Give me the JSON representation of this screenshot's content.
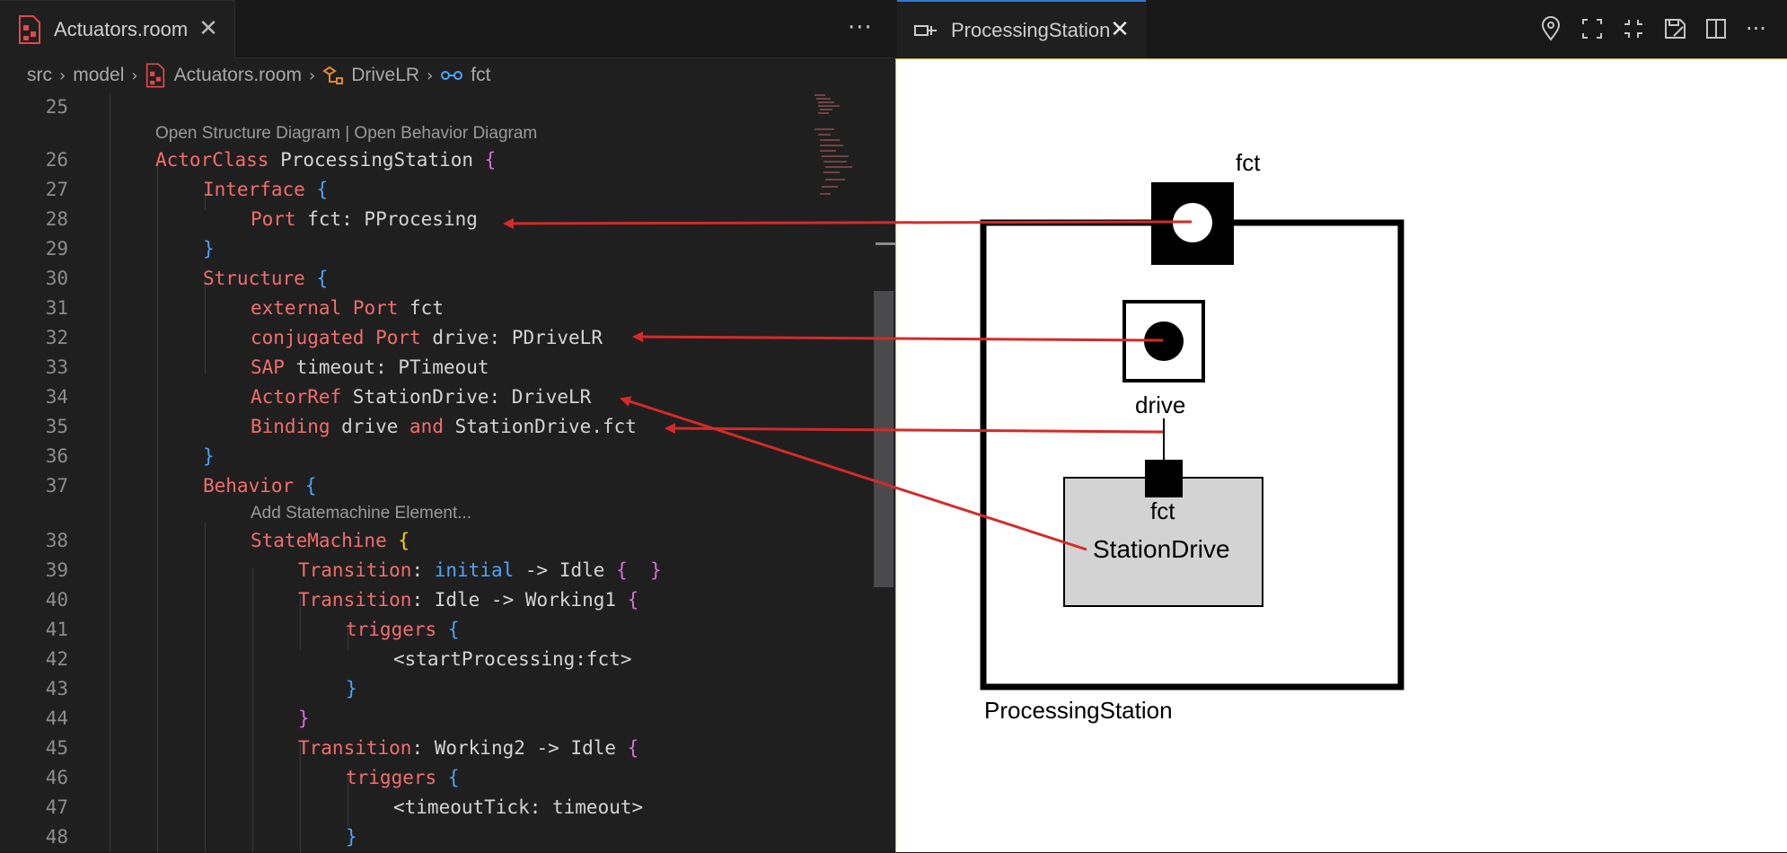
{
  "left_tab": {
    "label": "Actuators.room",
    "close": "✕"
  },
  "right_tab": {
    "label": "ProcessingStation",
    "close": "✕"
  },
  "more_actions": "···",
  "breadcrumb": [
    "src",
    "model",
    "Actuators.room",
    "DriveLR",
    "fct"
  ],
  "code_lens": {
    "structure_links": "Open Structure Diagram | Open Behavior Diagram",
    "add_statemachine": "Add Statemachine Element..."
  },
  "code_lines": {
    "l25": "25",
    "l26": "26",
    "l27": "27",
    "l28": "28",
    "l29": "29",
    "l30": "30",
    "l31": "31",
    "l32": "32",
    "l33": "33",
    "l34": "34",
    "l35": "35",
    "l36": "36",
    "l37": "37",
    "l38": "38",
    "l39": "39",
    "l40": "40",
    "l41": "41",
    "l42": "42",
    "l43": "43",
    "l44": "44",
    "l45": "45",
    "l46": "46",
    "l47": "47",
    "l48": "48"
  },
  "code": {
    "actorclass_kw": "ActorClass",
    "actorclass_name": " ProcessingStation ",
    "interface_kw": "Interface",
    "port_kw": "Port",
    "port_decl": " fct: PProcesing",
    "structure_kw": "Structure",
    "external_kw": "external",
    "port_kw2": "Port",
    "external_rest": " fct",
    "conjugated_kw": "conjugated",
    "conj_rest": " drive: PDriveLR",
    "sap_kw": "SAP",
    "sap_rest": " timeout: PTimeout",
    "actorref_kw": "ActorRef",
    "actorref_rest": " StationDrive: DriveLR",
    "binding_kw": "Binding",
    "binding_mid": " drive ",
    "and_kw": "and",
    "binding_rest": " StationDrive.fct",
    "behavior_kw": "Behavior",
    "statemachine_kw": "StateMachine",
    "transition_kw": "Transition",
    "initial_kw": "initial",
    "t1_rest": " -> Idle ",
    "t2_rest": " Idle -> Working1 ",
    "triggers_kw": "triggers",
    "trigger1": "<startProcessing:fct>",
    "t3_rest": " Working2 -> Idle ",
    "trigger2": "<timeoutTick: timeout>",
    "colon": ":",
    "open_brace": "{",
    "close_brace": "}",
    "empty_braces": "{  }"
  },
  "diagram": {
    "actor_label": "ProcessingStation",
    "port_fct_label": "fct",
    "port_drive_label": "drive",
    "inner_port_label": "fct",
    "ref_label": "StationDrive"
  },
  "colors": {
    "keyword": "#f26d6d",
    "keyword_blue": "#4fa3f7",
    "arrow": "#d42a2a"
  }
}
